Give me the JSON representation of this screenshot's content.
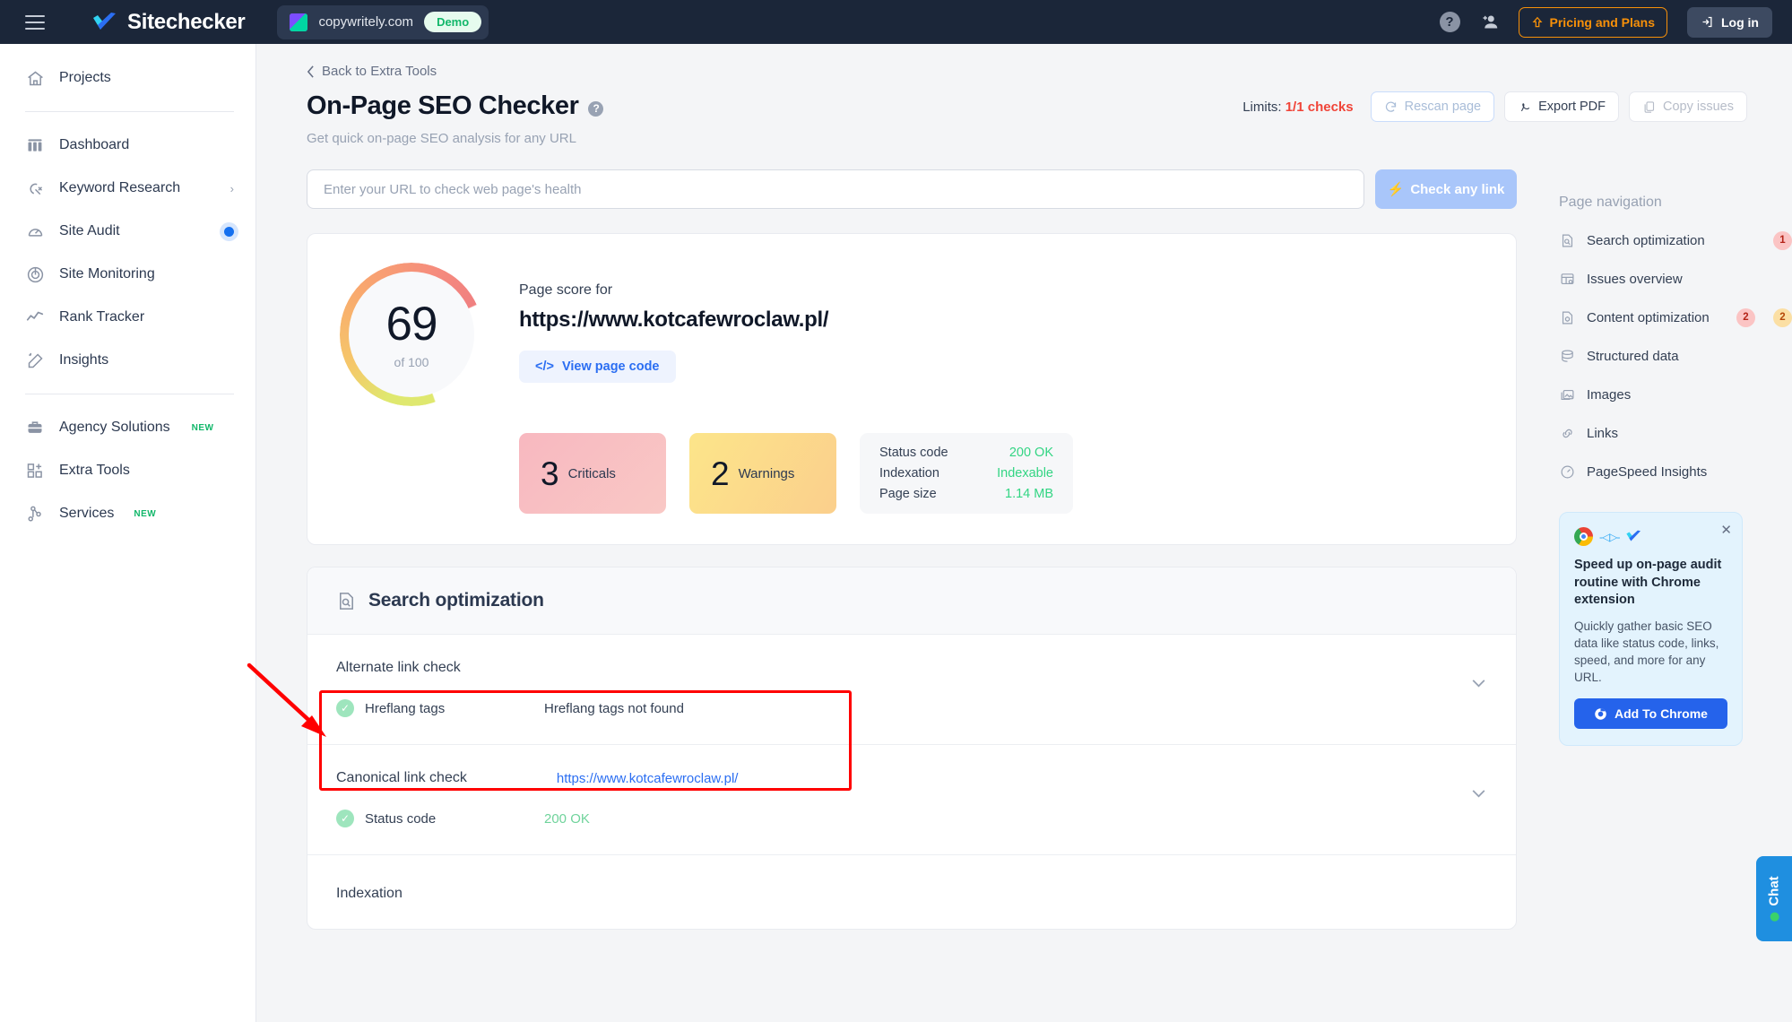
{
  "topbar": {
    "menu_icon": "hamburger-icon",
    "brand": "Sitechecker",
    "site": "copywritely.com",
    "demo_badge": "Demo",
    "help_icon": "?",
    "add_user_icon": "add-user-icon",
    "pricing_label": "Pricing and Plans",
    "login_label": "Log in",
    "accent_orange": "#f79009",
    "bar_bg": "#1b2639"
  },
  "sidebar": {
    "items": [
      {
        "label": "Projects",
        "icon": "home-icon"
      },
      {
        "label": "Dashboard",
        "icon": "dashboard-icon"
      },
      {
        "label": "Keyword Research",
        "icon": "keyword-research-icon",
        "chevron": "›"
      },
      {
        "label": "Site Audit",
        "icon": "site-audit-icon",
        "active_dot": true
      },
      {
        "label": "Site Monitoring",
        "icon": "site-monitoring-icon"
      },
      {
        "label": "Rank Tracker",
        "icon": "rank-tracker-icon"
      },
      {
        "label": "Insights",
        "icon": "insights-icon"
      },
      {
        "label": "Agency Solutions",
        "icon": "briefcase-icon",
        "tag": "NEW"
      },
      {
        "label": "Extra Tools",
        "icon": "extra-tools-icon"
      },
      {
        "label": "Services",
        "icon": "services-icon",
        "tag": "NEW"
      }
    ]
  },
  "page": {
    "back_label": "Back to Extra Tools",
    "title": "On-Page SEO Checker",
    "subtitle": "Get quick on-page SEO analysis for any URL",
    "limits_prefix": "Limits: ",
    "limits_value": "1/1 checks",
    "rescan_label": "Rescan page",
    "export_label": "Export PDF",
    "copy_label": "Copy issues"
  },
  "search": {
    "placeholder": "Enter your URL to check web page's health",
    "value": "",
    "button_label": "Check any link"
  },
  "score": {
    "value": "69",
    "of": "of 100",
    "label": "Page score for",
    "url": "https://www.kotcafewroclaw.pl/",
    "view_code_label": "View page code",
    "criticals_count": "3",
    "criticals_label": "Criticals",
    "warnings_count": "2",
    "warnings_label": "Warnings",
    "info": [
      {
        "key": "Status code",
        "value": "200 OK"
      },
      {
        "key": "Indexation",
        "value": "Indexable"
      },
      {
        "key": "Page size",
        "value": "1.14 MB"
      }
    ]
  },
  "sections": [
    {
      "title": "Search optimization",
      "icon": "search-optimization-icon",
      "rows": [
        {
          "title": "Alternate link check",
          "highlighted": true,
          "items": [
            {
              "key": "Hreflang tags",
              "value": "Hreflang tags not found",
              "status": "ok"
            }
          ]
        },
        {
          "title": "Canonical link check",
          "link_value": "https://www.kotcafewroclaw.pl/",
          "items": [
            {
              "key": "Status code",
              "value": "200 OK",
              "status": "ok",
              "value_green": true
            }
          ]
        },
        {
          "title": "Indexation",
          "items": []
        }
      ]
    }
  ],
  "rail": {
    "title": "Page navigation",
    "items": [
      {
        "label": "Search optimization",
        "icon": "search-optimization-icon",
        "red": "1"
      },
      {
        "label": "Issues overview",
        "icon": "issues-overview-icon"
      },
      {
        "label": "Content optimization",
        "icon": "content-optimization-icon",
        "red": "2",
        "yellow": "2"
      },
      {
        "label": "Structured data",
        "icon": "structured-data-icon"
      },
      {
        "label": "Images",
        "icon": "images-icon"
      },
      {
        "label": "Links",
        "icon": "links-icon"
      },
      {
        "label": "PageSpeed Insights",
        "icon": "pagespeed-icon"
      }
    ]
  },
  "promo": {
    "title": "Speed up on-page audit routine with Chrome extension",
    "body": "Quickly gather basic SEO data like status code, links, speed, and more for any URL.",
    "button_label": "Add To Chrome",
    "close_icon": "close-icon"
  },
  "chat": {
    "label": "Chat"
  },
  "annotation": {
    "color": "#ff0000",
    "type": "arrow-and-box"
  }
}
